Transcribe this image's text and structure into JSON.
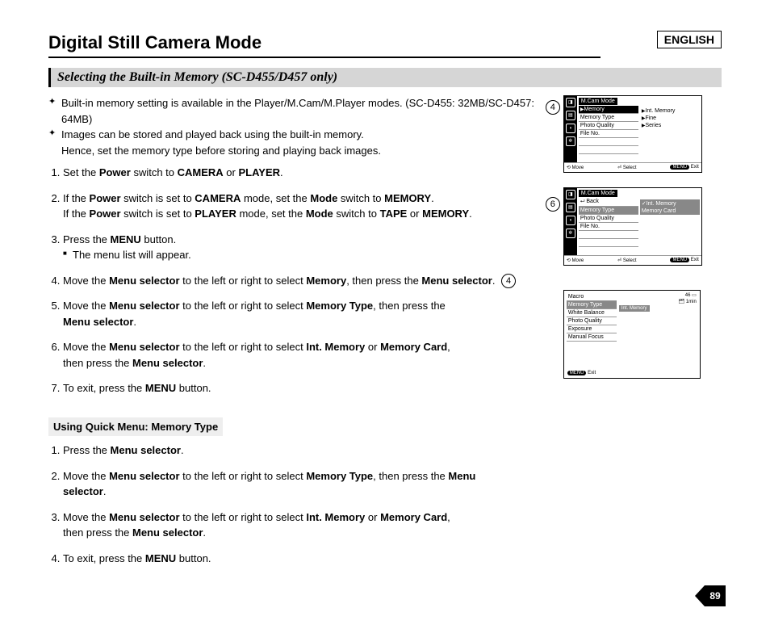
{
  "language_box": "ENGLISH",
  "page_title": "Digital Still Camera Mode",
  "subtitle": "Selecting the Built-in Memory (SC-D455/D457 only)",
  "bullets": {
    "b1": "Built-in memory setting is available in the Player/M.Cam/M.Player modes. (SC-D455: 32MB/SC-D457: 64MB)",
    "b2a": "Images can be stored and played back using the built-in memory.",
    "b2b": "Hence, set the memory type before storing and playing back images."
  },
  "steps": {
    "s1_a": "Set the ",
    "s1_b": "Power",
    "s1_c": " switch to ",
    "s1_d": "CAMERA",
    "s1_e": " or ",
    "s1_f": "PLAYER",
    "s1_g": ".",
    "s2_a": "If the ",
    "s2_b": "Power",
    "s2_c": " switch is set to ",
    "s2_d": "CAMERA",
    "s2_e": " mode, set the ",
    "s2_f": "Mode",
    "s2_g": " switch to ",
    "s2_h": "MEMORY",
    "s2_i": ".",
    "s2_j": "If the ",
    "s2_k": "Power",
    "s2_l": " switch is set to ",
    "s2_m": "PLAYER",
    "s2_n": " mode, set the ",
    "s2_o": "Mode",
    "s2_p": " switch to ",
    "s2_q": "TAPE",
    "s2_r": " or ",
    "s2_s": "MEMORY",
    "s2_t": ".",
    "s3_a": "Press the ",
    "s3_b": "MENU",
    "s3_c": " button.",
    "s3_sub": "The menu list will appear.",
    "s4_a": "Move the ",
    "s4_b": "Menu selector",
    "s4_c": " to the left or right to select ",
    "s4_d": "Memory",
    "s4_e": ", then press the ",
    "s4_f": "Menu selector",
    "s4_g": ".",
    "s5_a": "Move the ",
    "s5_b": "Menu selector",
    "s5_c": " to the left or right to select ",
    "s5_d": "Memory Type",
    "s5_e": ", then press the ",
    "s5_f": "Menu selector",
    "s5_g": ".",
    "s6_a": "Move the ",
    "s6_b": "Menu selector",
    "s6_c": " to the left or right to select ",
    "s6_d": "Int. Memory",
    "s6_e": " or ",
    "s6_f": "Memory Card",
    "s6_g": ",",
    "s6_h": "then press the ",
    "s6_i": "Menu selector",
    "s6_j": ".",
    "s7_a": "To exit, press the ",
    "s7_b": "MENU",
    "s7_c": " button."
  },
  "quick_heading": "Using Quick Menu: Memory Type",
  "qsteps": {
    "q1_a": "Press the ",
    "q1_b": "Menu selector",
    "q1_c": ".",
    "q2_a": "Move the ",
    "q2_b": "Menu selector",
    "q2_c": " to the left or right to select ",
    "q2_d": "Memory Type",
    "q2_e": ", then press the ",
    "q2_f": "Menu",
    "q2_g": "selector",
    "q2_h": ".",
    "q3_a": "Move the ",
    "q3_b": "Menu selector",
    "q3_c": " to the left or right to select ",
    "q3_d": "Int. Memory",
    "q3_e": " or ",
    "q3_f": "Memory Card",
    "q3_g": ",",
    "q3_h": "then press the ",
    "q3_i": "Menu selector",
    "q3_j": ".",
    "q4_a": "To exit, press the ",
    "q4_b": "MENU",
    "q4_c": " button."
  },
  "lcd4": {
    "title": "M.Cam Mode",
    "sel": "Memory",
    "rows": [
      "Memory Type",
      "Photo Quality",
      "File No."
    ],
    "vals": [
      "Int. Memory",
      "Fine",
      "Series"
    ],
    "foot_move": "Move",
    "foot_select": "Select",
    "foot_menu": "MENU",
    "foot_exit": "Exit"
  },
  "lcd6": {
    "title": "M.Cam Mode",
    "back": "Back",
    "rows": [
      "Memory Type",
      "Photo Quality",
      "File No."
    ],
    "vals": [
      "Int. Memory",
      "Memory Card"
    ],
    "foot_move": "Move",
    "foot_select": "Select",
    "foot_menu": "MENU",
    "foot_exit": "Exit"
  },
  "lcd_quick": {
    "rows": [
      "Macro",
      "Memory Type",
      "White Balance",
      "Photo Quality",
      "Exposure",
      "Manual Focus"
    ],
    "val": "Int. Memory",
    "count": "46",
    "time": "1min",
    "foot_menu": "MENU",
    "foot_exit": "Exit"
  },
  "markers": {
    "m4": "4",
    "m6": "6"
  },
  "page_number": "89"
}
